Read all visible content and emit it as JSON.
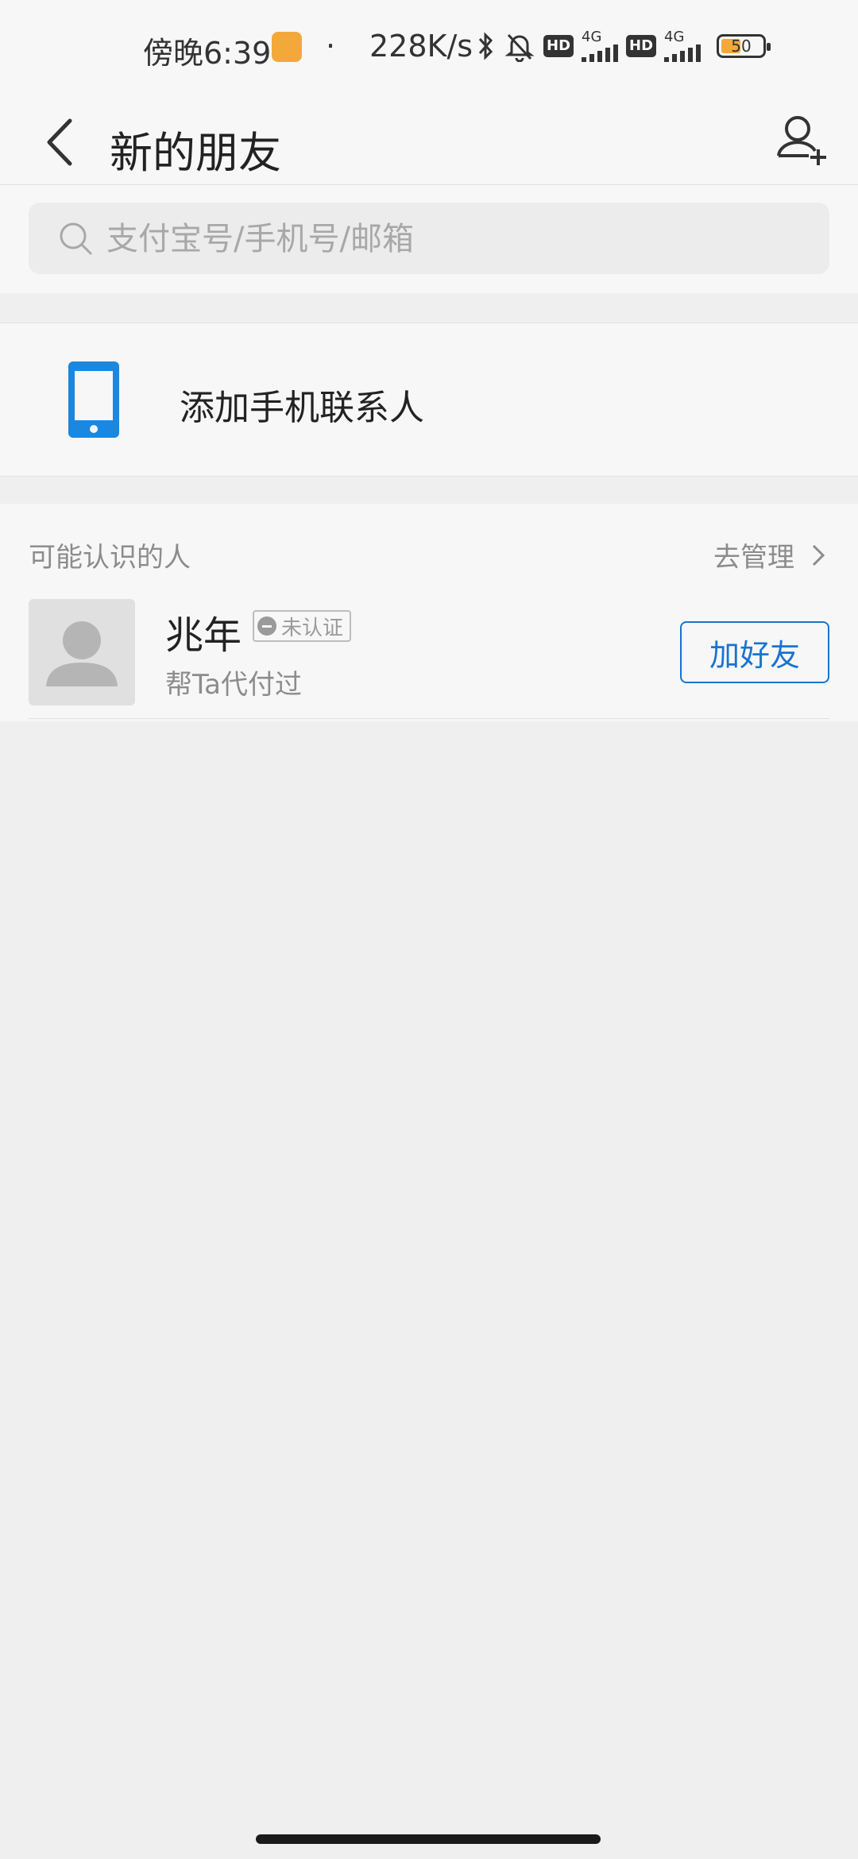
{
  "status_bar": {
    "time": "傍晚6:39",
    "dot": "·",
    "net_speed": "228K/s",
    "hd_label": "HD",
    "network_label": "4G",
    "battery_level": "50",
    "icons": [
      "bluetooth-icon",
      "mute-bell-icon",
      "signal-icon",
      "battery-icon"
    ]
  },
  "nav": {
    "title": "新的朋友",
    "back_icon": "chevron-left-icon",
    "add_icon": "add-user-icon"
  },
  "search": {
    "placeholder": "支付宝号/手机号/邮箱",
    "value": ""
  },
  "contacts": {
    "label": "添加手机联系人",
    "icon": "phone-icon",
    "icon_color": "#1a88e0"
  },
  "people_section": {
    "title": "可能认识的人",
    "manage_label": "去管理",
    "items": [
      {
        "name": "兆年",
        "badge": "未认证",
        "subtitle": "帮Ta代付过",
        "action": "加好友"
      }
    ]
  },
  "colors": {
    "accent": "#1a73d0",
    "background": "#efefef",
    "panel": "#f7f7f7"
  }
}
